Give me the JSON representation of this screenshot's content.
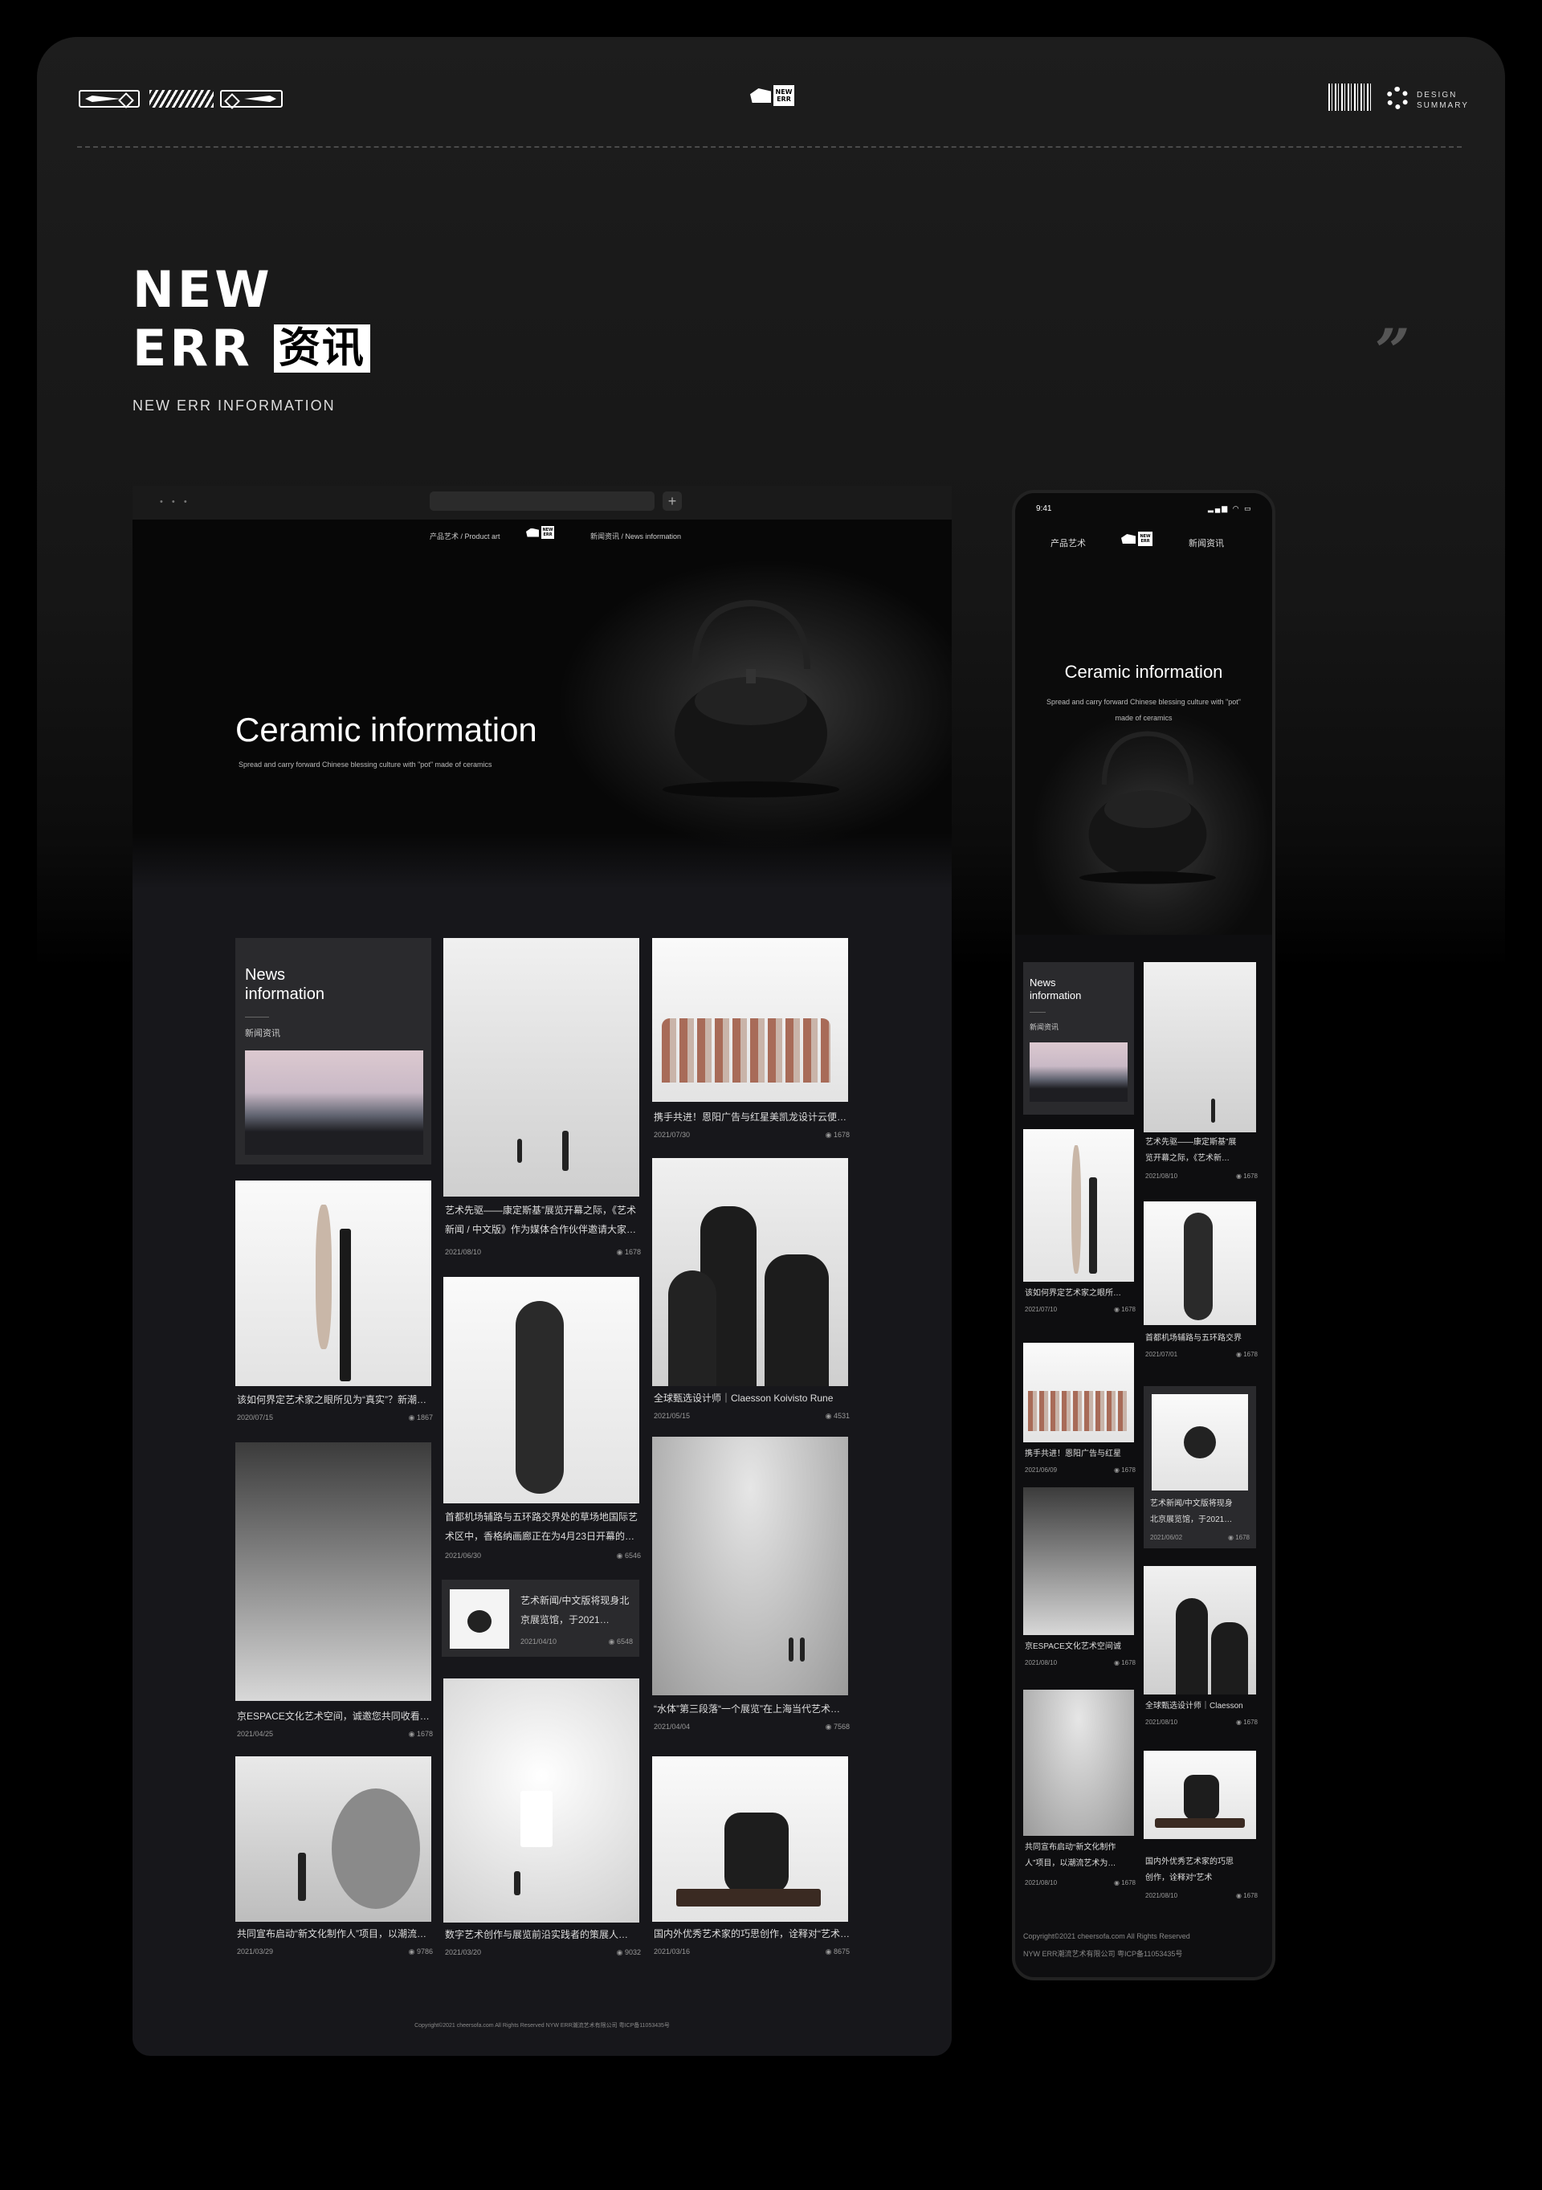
{
  "header": {
    "logo_line1": "NEW",
    "logo_line2": "ERR",
    "design_line1": "DESIGN",
    "design_line2": "SUMMARY"
  },
  "title": {
    "line1": "NEW",
    "line2": "ERR",
    "boxed": "资讯",
    "subtitle": "NEW ERR INFORMATION",
    "quote": "”"
  },
  "desktop": {
    "dots": "• • •",
    "plus": "+",
    "nav_left": "产品艺术 / Product art",
    "nav_right": "新闻资讯 / News information",
    "hero_title": "Ceramic information",
    "hero_sub": "Spread and carry forward Chinese blessing culture with \"pot\" made of ceramics",
    "news_heading_1": "News",
    "news_heading_2": "information",
    "news_cn": "新闻资讯",
    "cards": [
      {
        "caption": "该如何界定艺术家之眼所见为“真实”？新潮…",
        "date": "2020/07/15",
        "views": "1867"
      },
      {
        "caption": "京ESPACE文化艺术空间，诚邀您共同收看…",
        "date": "2021/04/25",
        "views": "1678"
      },
      {
        "caption": "共同宣布启动“新文化制作人”项目，以潮流…",
        "date": "2021/03/29",
        "views": "9786"
      },
      {
        "caption": "艺术先驱——康定斯基”展览开幕之际，《艺术",
        "caption2": "新闻 / 中文版》作为媒体合作伙伴邀请大家…",
        "date": "2021/08/10",
        "views": "1678"
      },
      {
        "caption": "首都机场辅路与五环路交界处的草场地国际艺",
        "caption2": "术区中，香格纳画廊正在为4月23日开幕的…",
        "date": "2021/06/30",
        "views": "6546"
      },
      {
        "caption": "数字艺术创作与展览前沿实践者的策展人…",
        "date": "2021/03/20",
        "views": "9032"
      },
      {
        "caption": "携手共进！恩阳广告与红星美凯龙设计云便…",
        "date": "2021/07/30",
        "views": "1678"
      },
      {
        "caption": "全球甄选设计师｜Claesson Koivisto Rune",
        "date": "2021/05/15",
        "views": "4531"
      },
      {
        "caption": "“水体”第三段落“一个展览”在上海当代艺术…",
        "date": "2021/04/04",
        "views": "7568"
      },
      {
        "caption": "国内外优秀艺术家的巧思创作，诠释对“艺术…",
        "date": "2021/03/16",
        "views": "8675"
      }
    ],
    "small_card": {
      "title": "艺术新闻/中文版将现身北京展览馆，于2021…",
      "date": "2021/04/10",
      "views": "6548"
    },
    "footer": "Copyright©2021 cheersofa.com All Rights Reserved    NYW ERR潮流艺术有限公司 粤ICP备11053435号"
  },
  "mobile": {
    "time": "9:41",
    "status": "▂▄▆ ◠ ▭",
    "nav_left": "产品艺术",
    "nav_right": "新闻资讯",
    "hero_title": "Ceramic information",
    "hero_sub": "Spread and carry forward Chinese blessing culture with \"pot\" made of ceramics",
    "news_heading_1": "News",
    "news_heading_2": "information",
    "news_cn": "新闻资讯",
    "cards": [
      {
        "caption": "艺术先驱——康定斯基”展",
        "caption2": "览开幕之际，《艺术新…",
        "date": "2021/08/10",
        "views": "1678"
      },
      {
        "caption": "该如何界定艺术家之眼所…",
        "date": "2021/07/10",
        "views": "1678"
      },
      {
        "caption": "首都机场辅路与五环路交界",
        "date": "2021/07/01",
        "views": "1678"
      },
      {
        "caption": "携手共进！恩阳广告与红星",
        "date": "2021/06/09",
        "views": "1678"
      },
      {
        "caption": "艺术新闻/中文版将现身",
        "caption2": "北京展览馆，于2021…",
        "date": "2021/06/02",
        "views": "1678"
      },
      {
        "caption": "京ESPACE文化艺术空间诚",
        "date": "2021/08/10",
        "views": "1678"
      },
      {
        "caption": "全球甄选设计师｜Claesson",
        "date": "2021/08/10",
        "views": "1678"
      },
      {
        "caption": "共同宣布启动“新文化制作",
        "caption2": "人”项目，以潮流艺术为…",
        "date": "2021/08/10",
        "views": "1678"
      },
      {
        "caption": "国内外优秀艺术家的巧思",
        "caption2": "创作，诠释对“艺术",
        "date": "2021/08/10",
        "views": "1678"
      }
    ],
    "footer1": "Copyright©2021 cheersofa.com All Rights Reserved",
    "footer2": "NYW ERR潮流艺术有限公司 粤ICP备11053435号"
  },
  "icons": {
    "views": "eye-icon"
  }
}
